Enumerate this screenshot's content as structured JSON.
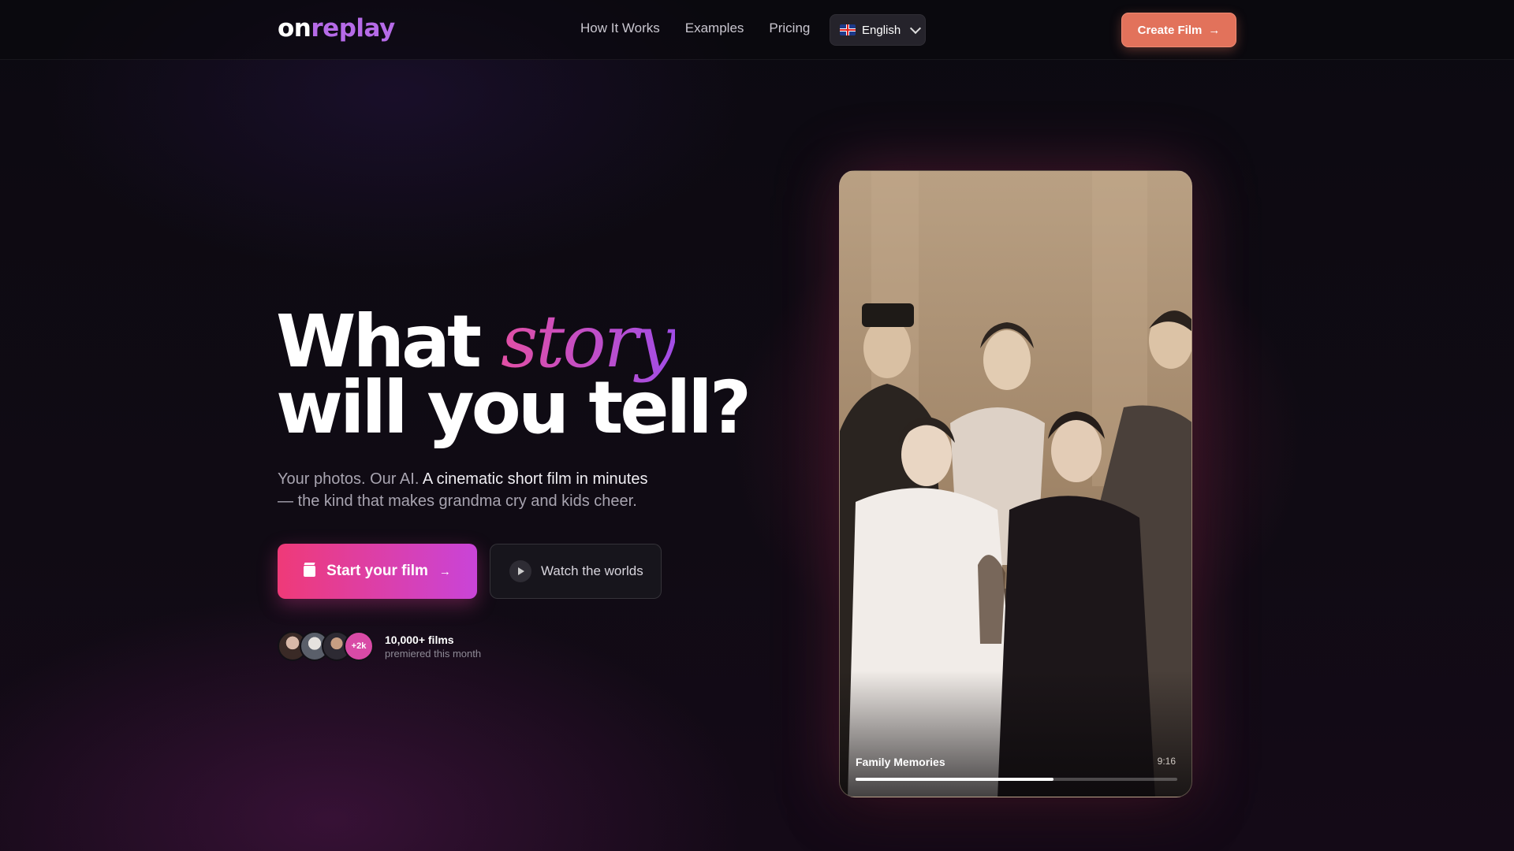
{
  "brand": {
    "part1": "on",
    "part2": "replay"
  },
  "nav": {
    "links": [
      "How It Works",
      "Examples",
      "Pricing"
    ],
    "language": "English",
    "cta": "Create Film"
  },
  "hero": {
    "title_word1": "What",
    "title_accent": "story",
    "title_line2": "will you tell?",
    "sub_plain": "Your photos. Our AI.",
    "sub_highlight": "A cinematic short film in minutes",
    "sub_rest": "— the kind that makes grandma cry and kids cheer.",
    "primary_button": "Start your film",
    "secondary_button": "Watch the worlds"
  },
  "social_proof": {
    "more_badge": "+2k",
    "count": "10,000+ films",
    "caption": "premiered this month"
  },
  "preview": {
    "title": "Family Memories",
    "aspect": "9:16",
    "progress": 0.615
  },
  "colors": {
    "accent": "#e2725b",
    "gradient_start": "#ef3a78",
    "gradient_end": "#c944d8",
    "logo_accent": "#b66be8"
  },
  "icons": [
    "flag-uk-icon",
    "chevron-down-icon",
    "arrow-right-icon",
    "film-icon",
    "play-icon"
  ]
}
